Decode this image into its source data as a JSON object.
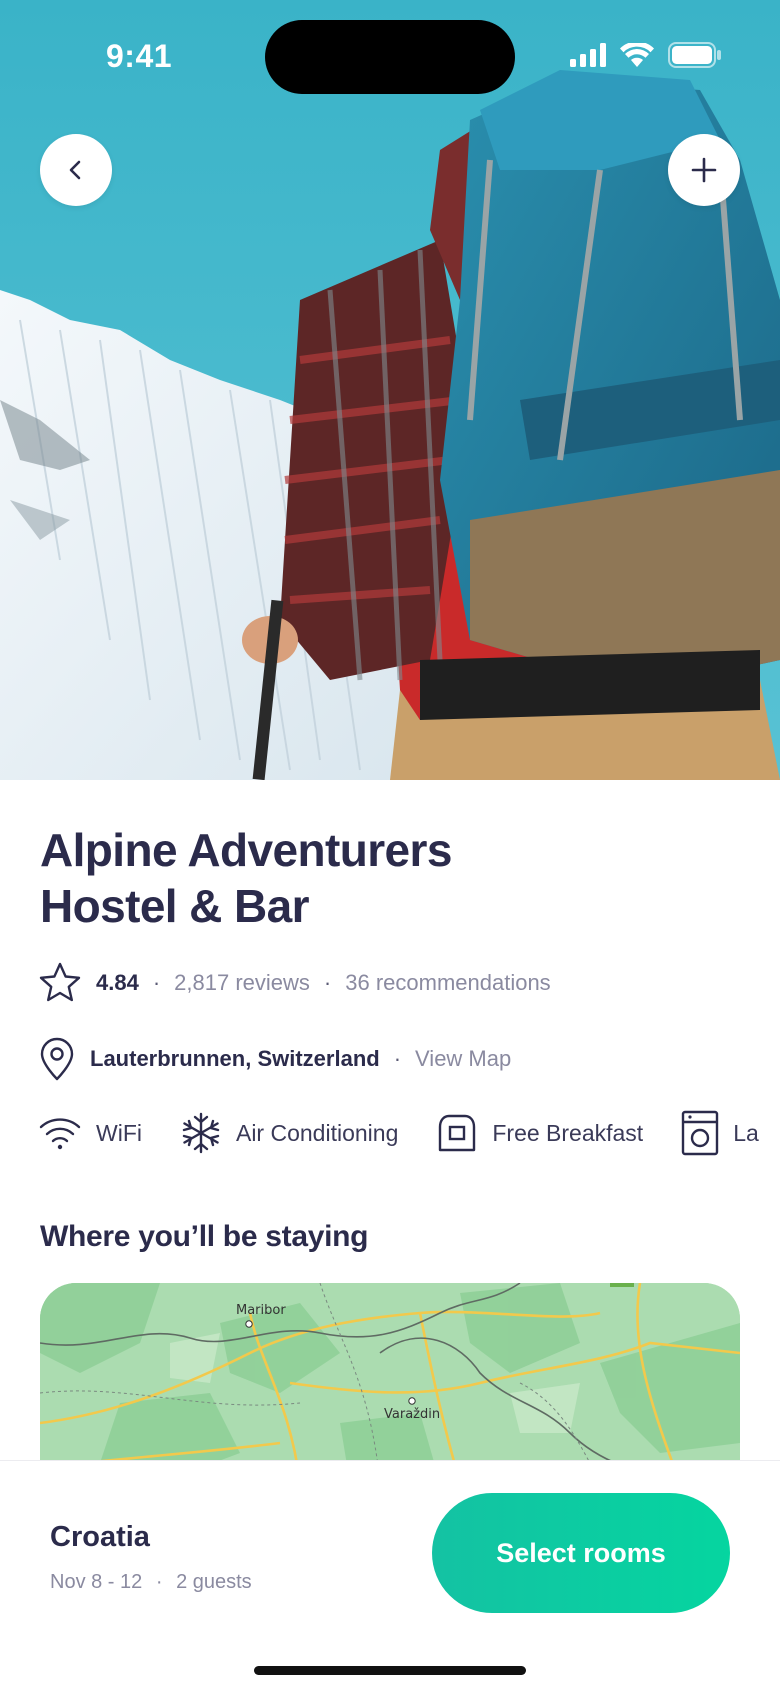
{
  "status_bar": {
    "time": "9:41",
    "icons": [
      "cellular-signal-icon",
      "wifi-icon",
      "battery-icon"
    ]
  },
  "hero": {
    "photo_subject": "hiker with backpack facing snowy mountain",
    "back_icon": "chevron-left-icon",
    "add_icon": "plus-icon"
  },
  "listing": {
    "title_line1": "Alpine Adventurers",
    "title_line2": "Hostel & Bar",
    "rating": "4.84",
    "reviews": "2,817 reviews",
    "recommendations": "36 recommendations",
    "separator": "·",
    "location": "Lauterbrunnen, Switzerland",
    "view_map": "View Map"
  },
  "amenities": [
    {
      "icon": "wifi-icon",
      "label": "WiFi"
    },
    {
      "icon": "snowflake-icon",
      "label": "Air Conditioning"
    },
    {
      "icon": "toaster-icon",
      "label": "Free Breakfast"
    },
    {
      "icon": "washing-machine-icon",
      "label": "La"
    }
  ],
  "map_section": {
    "title": "Where you’ll be staying",
    "labels": [
      "Maribor",
      "Varaždin"
    ]
  },
  "booking": {
    "destination": "Croatia",
    "dates": "Nov 8 - 12",
    "guests": "2 guests",
    "separator": "·",
    "cta": "Select rooms"
  },
  "colors": {
    "accent": "#0fcda2",
    "text_primary": "#2b2b4b",
    "text_muted": "#8a8aa0",
    "sky": "#3fb6c9",
    "map_green": "#a9dcae"
  }
}
